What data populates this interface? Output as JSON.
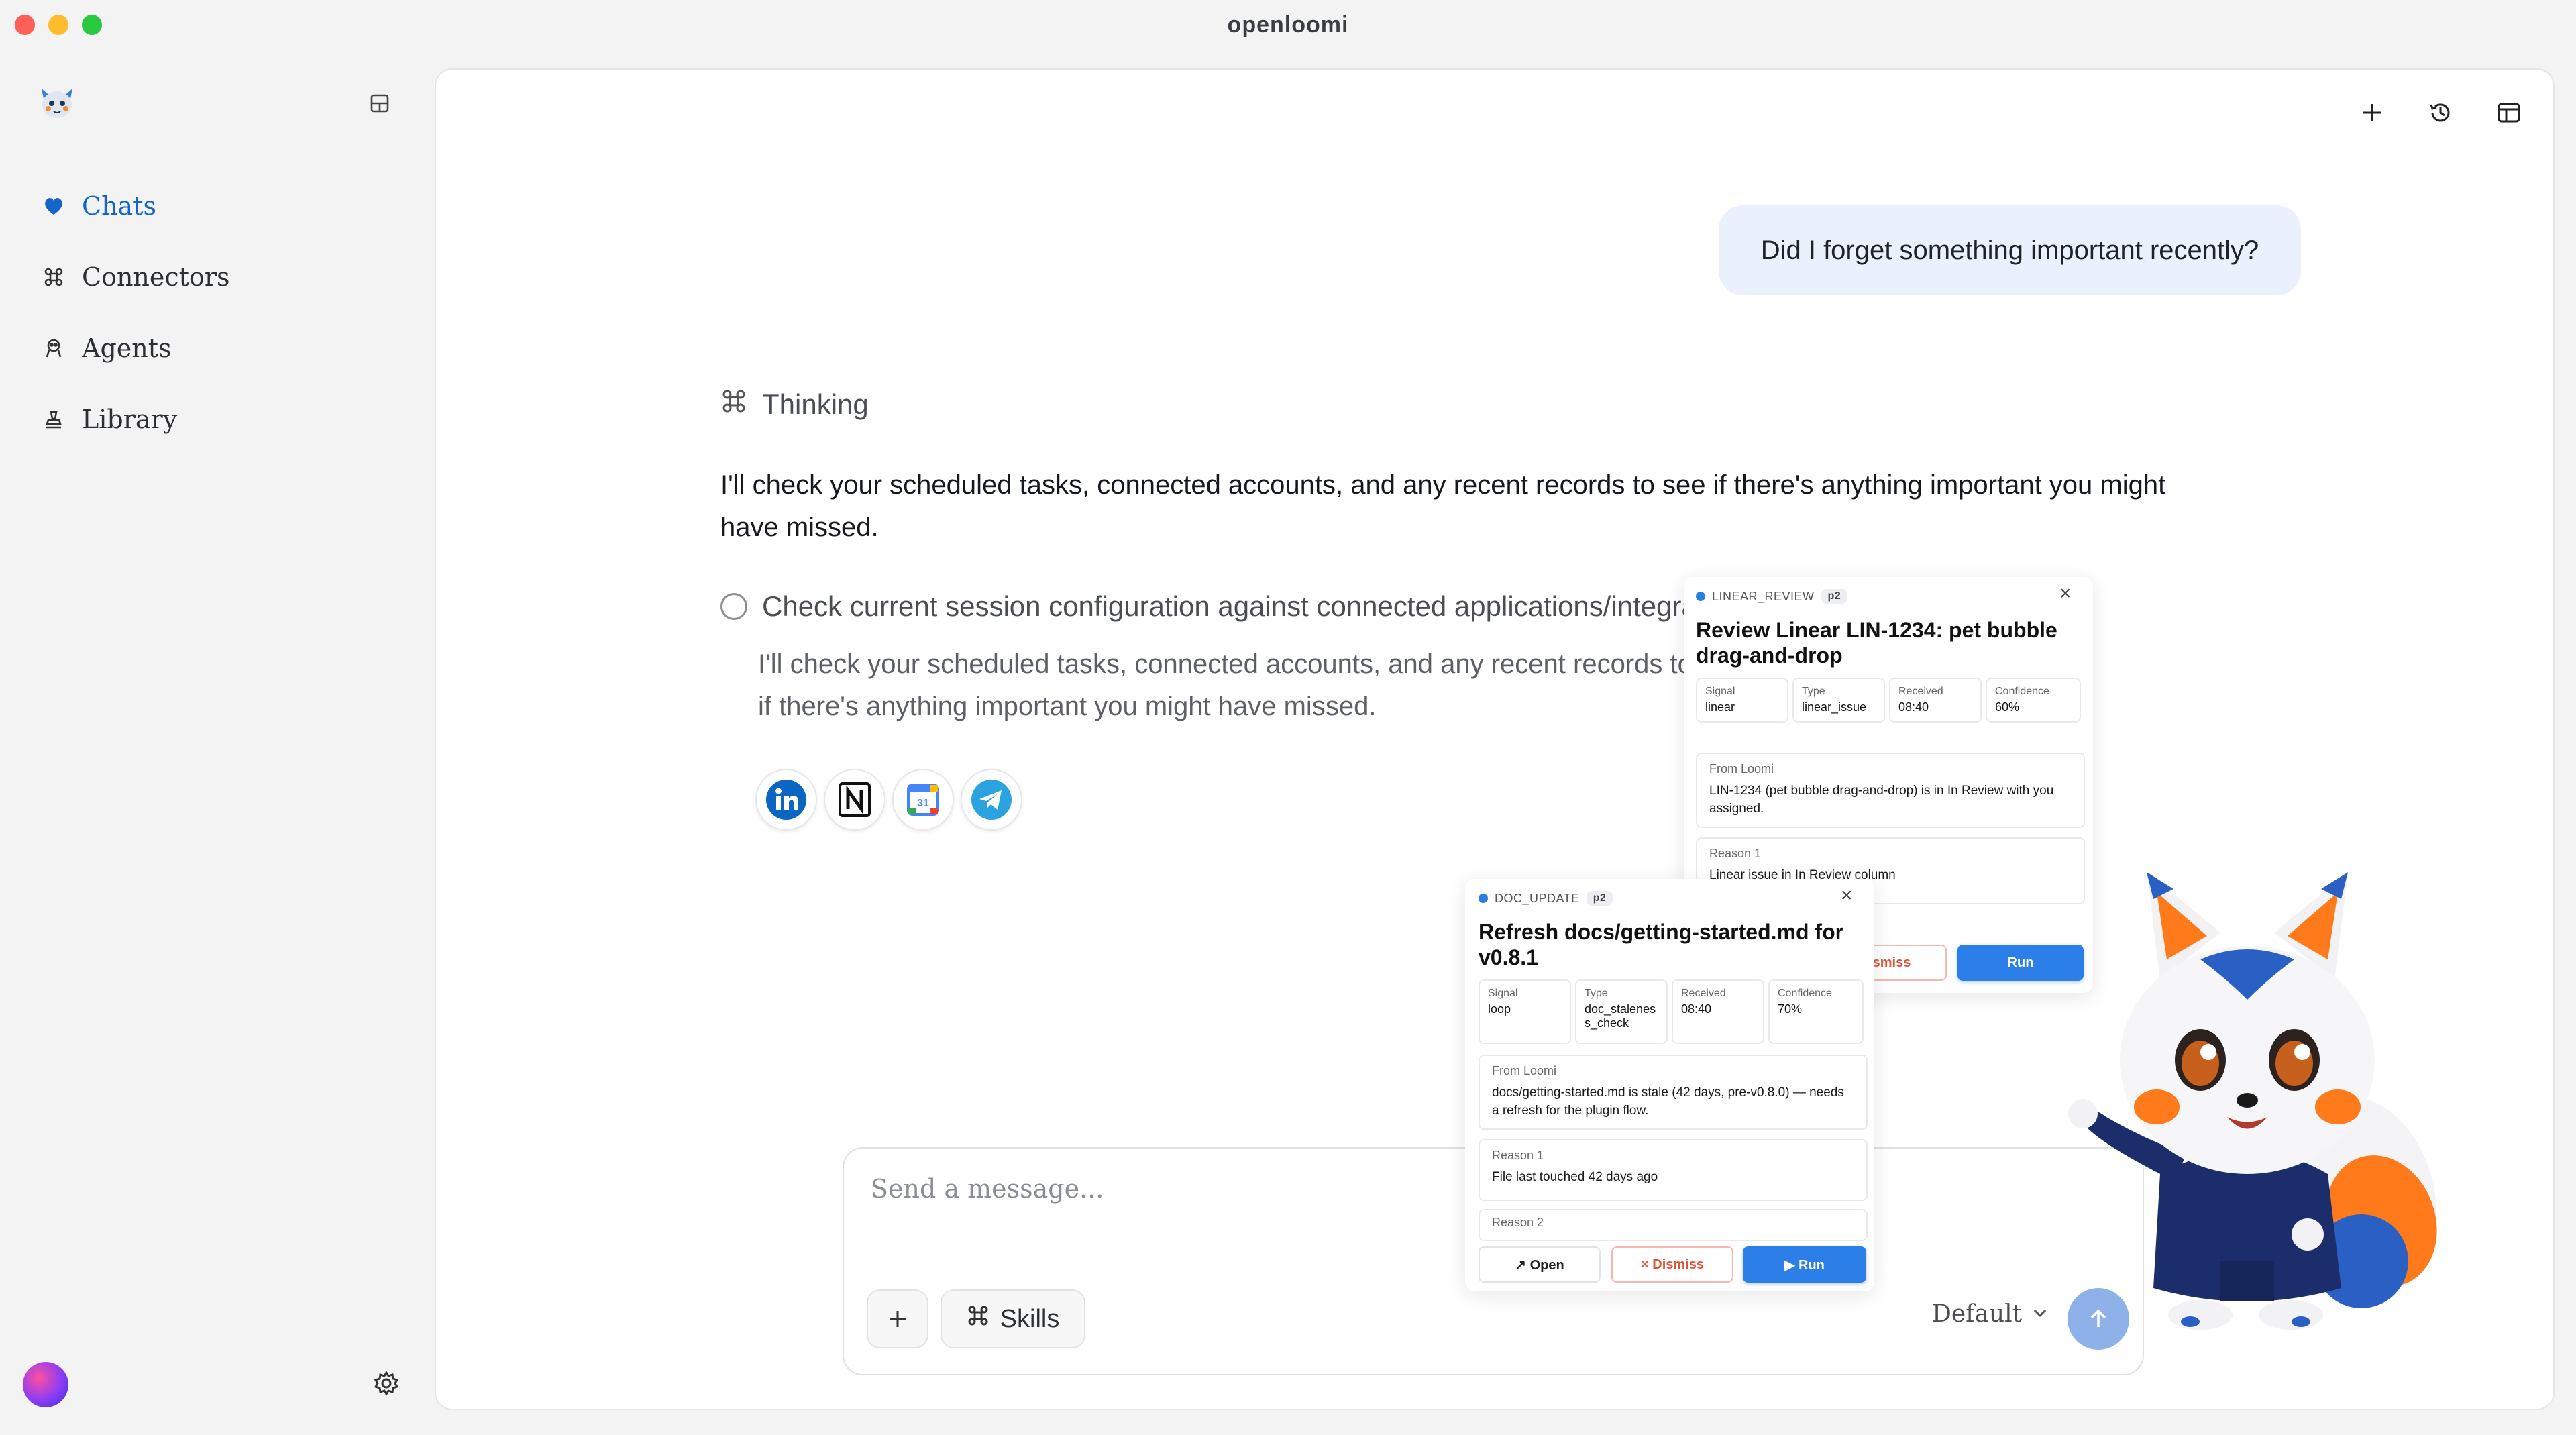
{
  "window": {
    "title": "openloomi"
  },
  "sidebar": {
    "items": [
      {
        "label": "Chats",
        "icon": "heart-icon",
        "active": true
      },
      {
        "label": "Connectors",
        "icon": "command-icon",
        "active": false
      },
      {
        "label": "Agents",
        "icon": "agents-icon",
        "active": false
      },
      {
        "label": "Library",
        "icon": "library-icon",
        "active": false
      }
    ]
  },
  "conversation": {
    "user_message": "Did I forget something important recently?",
    "thinking_label": "Thinking",
    "assistant_message": "I'll check your scheduled tasks, connected accounts, and any recent records to see if there's anything important you might have missed.",
    "step": {
      "title": "Check current session configuration against connected applications/integrations",
      "detail": "I'll check your scheduled tasks, connected accounts, and any recent records to see if there's anything important you might have missed."
    },
    "connectors": [
      "linkedin-icon",
      "notion-icon",
      "google-calendar-icon",
      "telegram-icon"
    ]
  },
  "composer": {
    "placeholder": "Send a message...",
    "skills_label": "Skills",
    "model_label": "Default"
  },
  "card_linear": {
    "tag": "LINEAR_REVIEW",
    "priority": "p2",
    "title": "Review Linear LIN-1234: pet bubble drag-and-drop",
    "meta": [
      {
        "label": "Signal",
        "value": "linear"
      },
      {
        "label": "Type",
        "value": "linear_issue"
      },
      {
        "label": "Received",
        "value": "08:40"
      },
      {
        "label": "Confidence",
        "value": "60%"
      }
    ],
    "from_label": "From Loomi",
    "from_text": "LIN-1234 (pet bubble drag-and-drop) is in In Review with you assigned.",
    "reason1_label": "Reason 1",
    "reason1_text": "Linear issue in In Review column",
    "dismiss": "Dismiss",
    "run": "Run"
  },
  "card_doc": {
    "tag": "DOC_UPDATE",
    "priority": "p2",
    "title": "Refresh docs/getting-started.md for v0.8.1",
    "meta": [
      {
        "label": "Signal",
        "value": "loop"
      },
      {
        "label": "Type",
        "value": "doc_staleness_check"
      },
      {
        "label": "Received",
        "value": "08:40"
      },
      {
        "label": "Confidence",
        "value": "70%"
      }
    ],
    "from_label": "From Loomi",
    "from_text": "docs/getting-started.md is stale (42 days, pre-v0.8.0) — needs a refresh for the plugin flow.",
    "reason1_label": "Reason 1",
    "reason1_text": "File last touched 42 days ago",
    "reason2_label": "Reason 2",
    "open": "↗ Open",
    "dismiss": "× Dismiss",
    "run": "▶ Run"
  },
  "colors": {
    "accent": "#1565c8",
    "run_button": "#2c7fe8",
    "user_bubble": "#eaf1fc",
    "send_button": "#8fb1ea"
  }
}
